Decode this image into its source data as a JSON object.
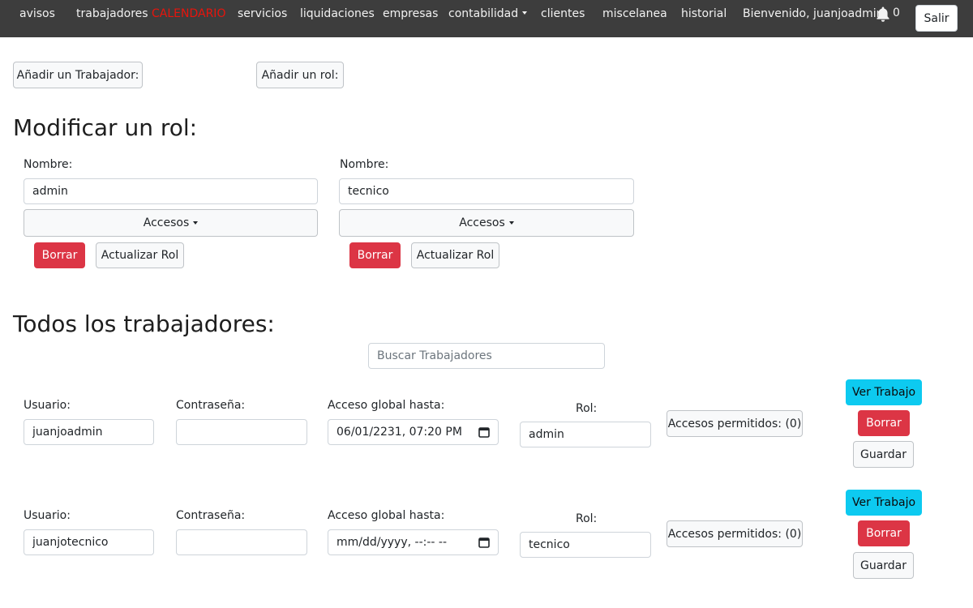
{
  "nav": {
    "items": [
      {
        "label": "avisos",
        "dropdown": false
      },
      {
        "label": "trabajadores",
        "dropdown": false
      },
      {
        "label": "CALENDARIO",
        "dropdown": false
      },
      {
        "label": "servicios",
        "dropdown": false
      },
      {
        "label": "liquidaciones",
        "dropdown": false
      },
      {
        "label": "empresas",
        "dropdown": false
      },
      {
        "label": "contabilidad",
        "dropdown": true
      },
      {
        "label": "clientes",
        "dropdown": false
      },
      {
        "label": "miscelanea",
        "dropdown": false
      },
      {
        "label": "historial",
        "dropdown": false
      }
    ],
    "welcome": "Bienvenido, juanjoadmin",
    "notification_count": "0",
    "logout_label": "Salir",
    "accent_color": "#e8140c"
  },
  "top_actions": {
    "add_worker": "Añadir un Trabajador:",
    "add_role": "Añadir un rol:"
  },
  "roles_section": {
    "title": "Modificar un rol:",
    "roles": [
      {
        "name_label": "Nombre:",
        "name_value": "admin",
        "access_label": "Accesos",
        "delete_label": "Borrar",
        "update_label": "Actualizar Rol"
      },
      {
        "name_label": "Nombre:",
        "name_value": "tecnico",
        "access_label": "Accesos",
        "delete_label": "Borrar",
        "update_label": "Actualizar Rol"
      }
    ]
  },
  "workers_section": {
    "title": "Todos los trabajadores:",
    "search_placeholder": "Buscar Trabajadores",
    "workers": [
      {
        "user_label": "Usuario:",
        "user_value": "juanjoadmin",
        "password_label": "Contraseña:",
        "password_value": "",
        "access_until_label": "Acceso global hasta:",
        "access_until_value": "06/01/2231, 07:20 PM",
        "role_label": "Rol:",
        "role_value": "admin",
        "permissions_label": "Accesos permitidos: (0)",
        "view_label": "Ver Trabajo",
        "delete_label": "Borrar",
        "save_label": "Guardar"
      },
      {
        "user_label": "Usuario:",
        "user_value": "juanjotecnico",
        "password_label": "Contraseña:",
        "password_value": "",
        "access_until_label": "Acceso global hasta:",
        "access_until_value": "mm/dd/yyyy, --:-- --",
        "role_label": "Rol:",
        "role_value": "tecnico",
        "permissions_label": "Accesos permitidos: (0)",
        "view_label": "Ver Trabajo",
        "delete_label": "Borrar",
        "save_label": "Guardar"
      }
    ]
  }
}
